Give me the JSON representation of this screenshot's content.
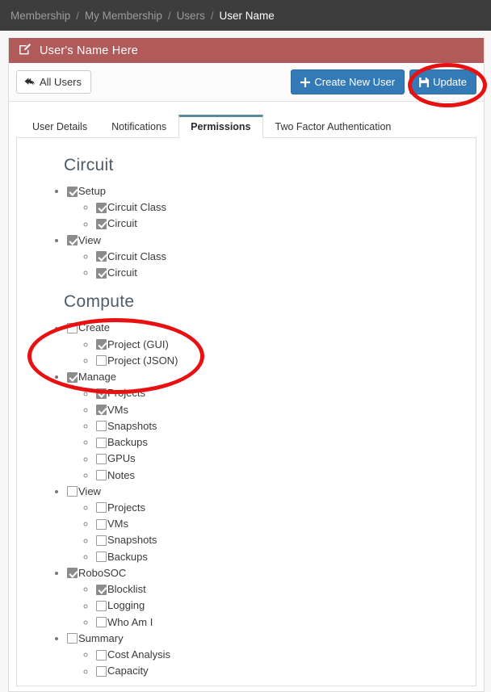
{
  "breadcrumb": {
    "separator": "/",
    "items": [
      {
        "label": "Membership",
        "active": false
      },
      {
        "label": "My Membership",
        "active": false
      },
      {
        "label": "Users",
        "active": false
      },
      {
        "label": "User Name",
        "active": true
      }
    ]
  },
  "panel": {
    "title": "User's Name Here",
    "title_icon": "edit-square-icon",
    "header_color": "#b05a5a"
  },
  "toolbar": {
    "all_users_label": "All Users",
    "all_users_icon": "reply-back-arrow-icon",
    "create_label": "Create New User",
    "create_icon": "plus-icon",
    "update_label": "Update",
    "update_icon": "floppy-save-icon",
    "primary_color": "#337ab7"
  },
  "tabs": [
    {
      "label": "User Details",
      "active": false
    },
    {
      "label": "Notifications",
      "active": false
    },
    {
      "label": "Permissions",
      "active": true
    },
    {
      "label": "Two Factor Authentication",
      "active": false
    }
  ],
  "permissions": {
    "sections": [
      {
        "title": "Circuit",
        "groups": [
          {
            "label": "Setup",
            "checked": true,
            "children": [
              {
                "label": "Circuit Class",
                "checked": true
              },
              {
                "label": "Circuit",
                "checked": true
              }
            ]
          },
          {
            "label": "View",
            "checked": true,
            "children": [
              {
                "label": "Circuit Class",
                "checked": true
              },
              {
                "label": "Circuit",
                "checked": true
              }
            ]
          }
        ]
      },
      {
        "title": "Compute",
        "groups": [
          {
            "label": "Create",
            "checked": false,
            "children": [
              {
                "label": "Project (GUI)",
                "checked": true
              },
              {
                "label": "Project (JSON)",
                "checked": false
              }
            ]
          },
          {
            "label": "Manage",
            "checked": true,
            "children": [
              {
                "label": "Projects",
                "checked": true
              },
              {
                "label": "VMs",
                "checked": true
              },
              {
                "label": "Snapshots",
                "checked": false
              },
              {
                "label": "Backups",
                "checked": false
              },
              {
                "label": "GPUs",
                "checked": false
              },
              {
                "label": "Notes",
                "checked": false
              }
            ]
          },
          {
            "label": "View",
            "checked": false,
            "children": [
              {
                "label": "Projects",
                "checked": false
              },
              {
                "label": "VMs",
                "checked": false
              },
              {
                "label": "Snapshots",
                "checked": false
              },
              {
                "label": "Backups",
                "checked": false
              }
            ]
          },
          {
            "label": "RoboSOC",
            "checked": true,
            "children": [
              {
                "label": "Blocklist",
                "checked": true
              },
              {
                "label": "Logging",
                "checked": false
              },
              {
                "label": "Who Am I",
                "checked": false
              }
            ]
          },
          {
            "label": "Summary",
            "checked": false,
            "children": [
              {
                "label": "Cost Analysis",
                "checked": false
              },
              {
                "label": "Capacity",
                "checked": false
              }
            ]
          }
        ]
      }
    ]
  },
  "annotations": [
    {
      "name": "update-button-highlight",
      "shape": "ellipse",
      "color": "#e81010"
    },
    {
      "name": "create-permissions-highlight",
      "shape": "ellipse",
      "color": "#e81010"
    }
  ]
}
